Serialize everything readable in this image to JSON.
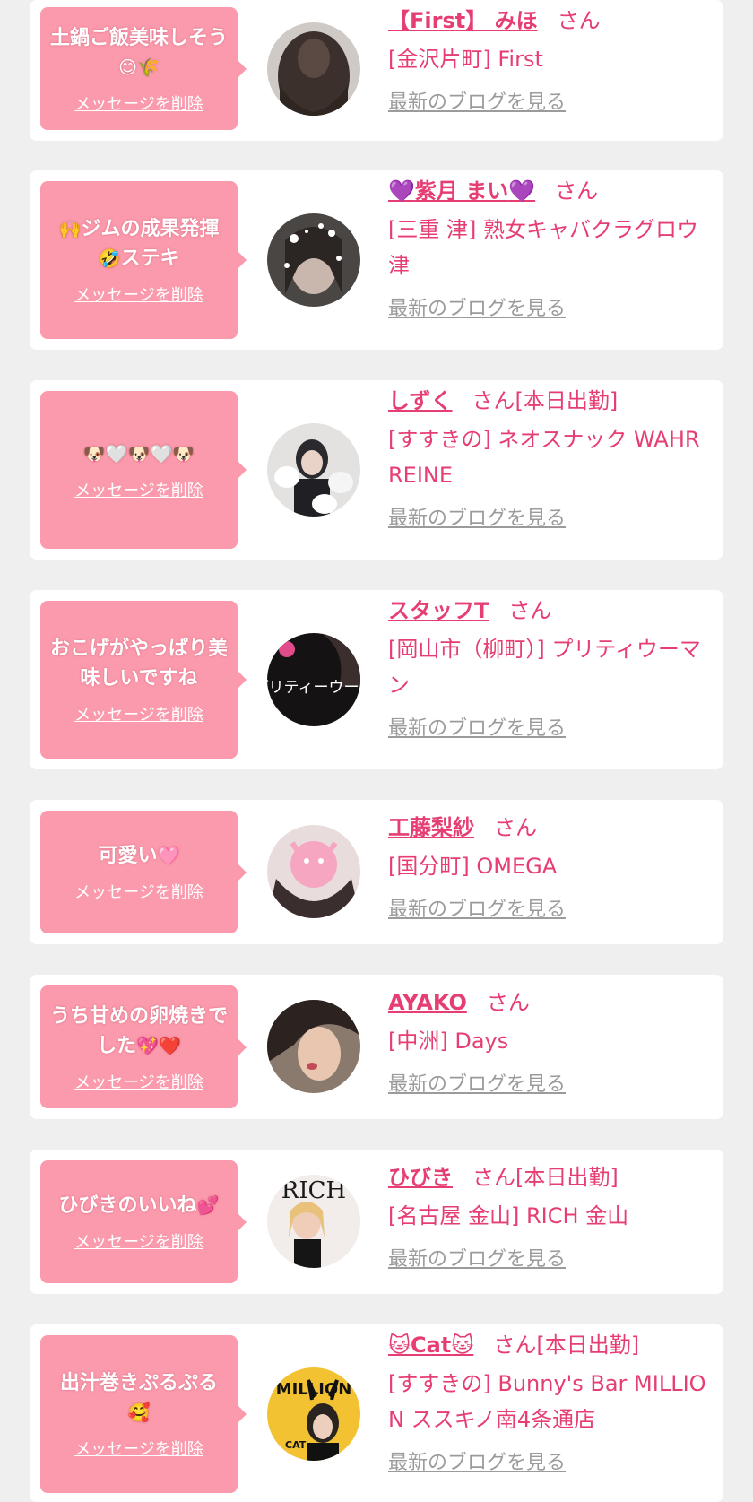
{
  "cards": [
    {
      "message": "土鍋ご飯美味しそう",
      "message_emoji": "😊🌾",
      "delete_label": "メッセージを削除",
      "name": "【First】 みほ",
      "suffix": "さん",
      "status": "",
      "shop": "[金沢片町] First",
      "blog_label": "最新のブログを見る",
      "avatar": "avatar-curly-hair-photo"
    },
    {
      "message_emoji": "🙌",
      "message": "ジムの成果発揮",
      "message_emoji2": "🤣",
      "message2": "ステキ",
      "delete_label": "メッセージを削除",
      "name_emoji": "💜",
      "name": "紫月 まい",
      "name_emoji_end": "💜",
      "suffix": "さん",
      "status": "",
      "shop": "[三重 津] 熟女キャバクラグロウ津",
      "blog_label": "最新のブログを見る",
      "avatar": "avatar-sparkle-photo"
    },
    {
      "message": "",
      "message_emoji": "🐶🤍🐶🤍🐶",
      "delete_label": "メッセージを削除",
      "name": "しずく",
      "suffix": "さん",
      "status": "[本日出勤]",
      "shop": "[すすきの] ネオスナック WAHR REINE",
      "blog_label": "最新のブログを見る",
      "avatar": "avatar-dogs-photo"
    },
    {
      "message": "おこげがやっぱり美味しいですね",
      "message_emoji": "",
      "delete_label": "メッセージを削除",
      "name": "スタッフT",
      "suffix": "さん",
      "status": "",
      "shop": "[岡山市（柳町）] プリティウーマン",
      "blog_label": "最新のブログを見る",
      "avatar": "avatar-pretty-woman-logo",
      "avatar_text": "プリティーウーマ"
    },
    {
      "message": "可愛い",
      "message_emoji": "🩷",
      "delete_label": "メッセージを削除",
      "name": "工藤梨紗",
      "suffix": "さん",
      "status": "",
      "shop": "[国分町] OMEGA",
      "blog_label": "最新のブログを見る",
      "avatar": "avatar-face-sticker-photo"
    },
    {
      "message": "うち甘めの卵焼きでした",
      "message_emoji": "💖❤️",
      "delete_label": "メッセージを削除",
      "name": "AYAKO",
      "suffix": "さん",
      "status": "",
      "shop": "[中洲] Days",
      "blog_label": "最新のブログを見る",
      "avatar": "avatar-portrait-photo"
    },
    {
      "message": "ひびきのいいね",
      "message_emoji": "💕",
      "delete_label": "メッセージを削除",
      "name": "ひびき",
      "suffix": "さん",
      "status": "[本日出勤]",
      "shop": "[名古屋 金山] RICH 金山",
      "blog_label": "最新のブログを見る",
      "avatar": "avatar-rich-magazine",
      "avatar_text": "RICH"
    },
    {
      "message": "出汁巻きぷるぷる",
      "message_emoji": "🥰",
      "delete_label": "メッセージを削除",
      "name_emoji": "🐱",
      "name": "Cat",
      "name_emoji_end": "🐱",
      "suffix": "さん",
      "status": "[本日出勤]",
      "shop": "[すすきの] Bunny's Bar MILLION ススキノ南4条通店",
      "blog_label": "最新のブログを見る",
      "avatar": "avatar-million-magazine",
      "avatar_text": "MILLION",
      "avatar_text2": "CAT"
    }
  ],
  "colors": {
    "page_bg": "#efefef",
    "card_bg": "#ffffff",
    "bubble": "#fb9aac",
    "accent": "#e63e73",
    "link_gray": "#9b9b9b"
  }
}
